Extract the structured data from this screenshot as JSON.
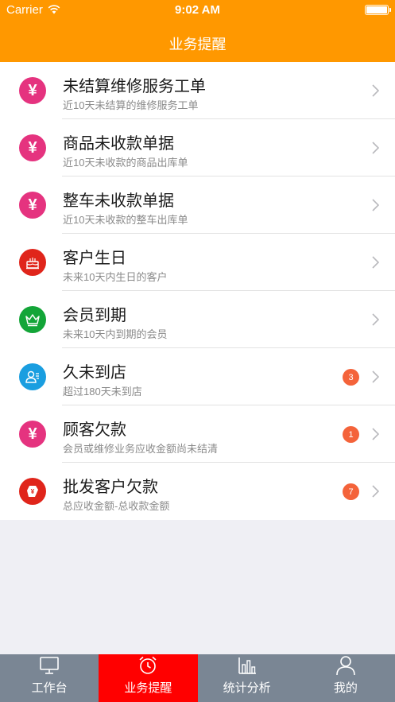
{
  "status_bar": {
    "carrier": "Carrier",
    "time": "9:02 AM"
  },
  "nav": {
    "title": "业务提醒"
  },
  "colors": {
    "header": "#ff9800",
    "tab_active": "#ff0000",
    "tabbar": "#7a8694",
    "badge": "#f4633a"
  },
  "rows": [
    {
      "icon": "yen-icon",
      "icon_color": "#e5337f",
      "glyph": "¥",
      "title": "未结算维修服务工单",
      "subtitle": "近10天未结算的维修服务工单",
      "badge": ""
    },
    {
      "icon": "yen-icon",
      "icon_color": "#e5337f",
      "glyph": "¥",
      "title": "商品未收款单据",
      "subtitle": "近10天未收款的商品出库单",
      "badge": ""
    },
    {
      "icon": "yen-icon",
      "icon_color": "#e5337f",
      "glyph": "¥",
      "title": "整车未收款单据",
      "subtitle": "近10天未收款的整车出库单",
      "badge": ""
    },
    {
      "icon": "cake-icon",
      "icon_color": "#e0251b",
      "glyph": "",
      "title": "客户生日",
      "subtitle": "未来10天内生日的客户",
      "badge": ""
    },
    {
      "icon": "crown-icon",
      "icon_color": "#13a538",
      "glyph": "",
      "title": "会员到期",
      "subtitle": "未来10天内到期的会员",
      "badge": ""
    },
    {
      "icon": "person-icon",
      "icon_color": "#1a9ee0",
      "glyph": "",
      "title": "久未到店",
      "subtitle": "超过180天未到店",
      "badge": "3"
    },
    {
      "icon": "yen-icon",
      "icon_color": "#e5337f",
      "glyph": "¥",
      "title": "顾客欠款",
      "subtitle": "会员或维修业务应收金额尚未结清",
      "badge": "1"
    },
    {
      "icon": "wholesale-icon",
      "icon_color": "#e0251b",
      "glyph": "",
      "title": "批发客户欠款",
      "subtitle": "总应收金额-总收款金额",
      "badge": "7"
    }
  ],
  "tabs": [
    {
      "icon": "monitor-icon",
      "label": "工作台",
      "active": false
    },
    {
      "icon": "alarm-clock-icon",
      "label": "业务提醒",
      "active": true
    },
    {
      "icon": "bar-chart-icon",
      "label": "统计分析",
      "active": false
    },
    {
      "icon": "user-icon",
      "label": "我的",
      "active": false
    }
  ]
}
